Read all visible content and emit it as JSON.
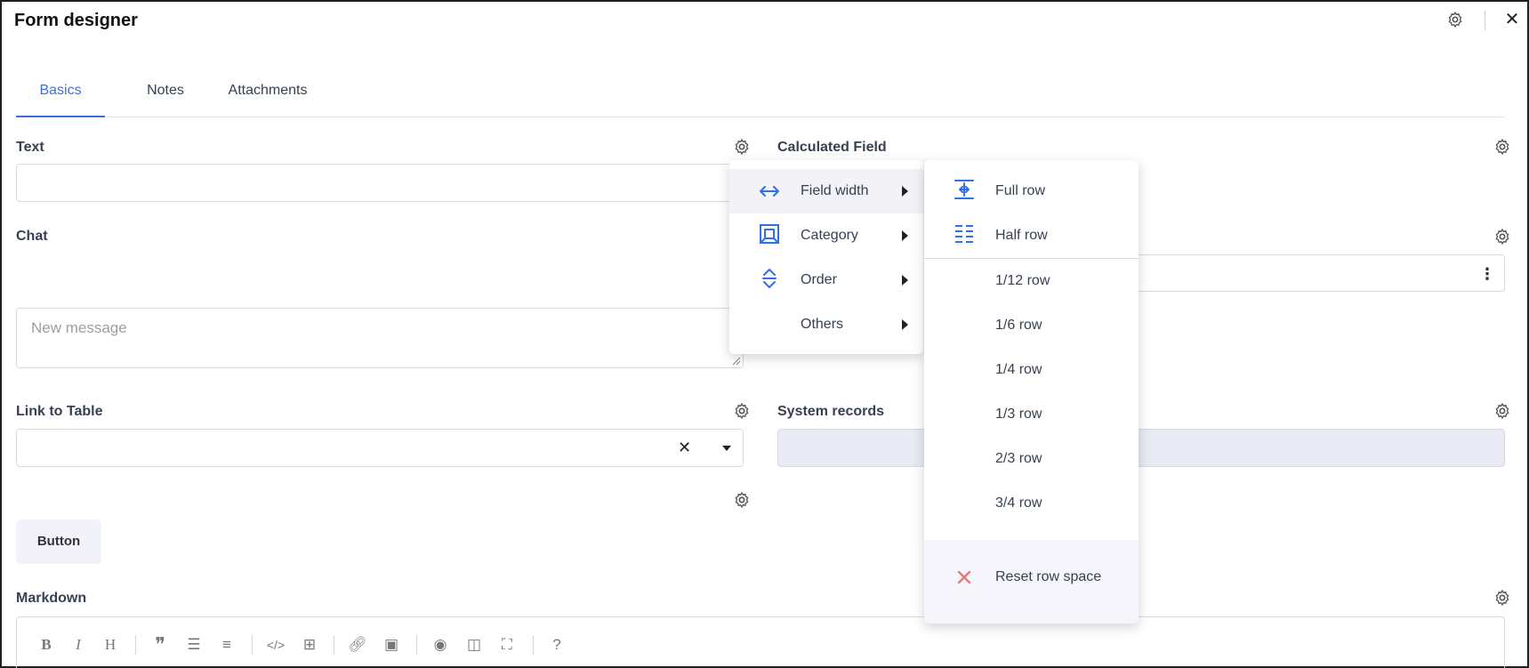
{
  "window": {
    "title": "Form designer"
  },
  "tabs": [
    {
      "label": "Basics",
      "active": true
    },
    {
      "label": "Notes",
      "active": false
    },
    {
      "label": "Attachments",
      "active": false
    }
  ],
  "fields": {
    "text": {
      "label": "Text"
    },
    "calculated": {
      "label": "Calculated Field"
    },
    "chat": {
      "label": "Chat",
      "placeholder": "New message"
    },
    "link_to_table": {
      "label": "Link to Table"
    },
    "system_records": {
      "label": "System records"
    },
    "button": {
      "label": "Button"
    },
    "markdown": {
      "label": "Markdown"
    }
  },
  "markdown_toolbar": [
    "bold-icon",
    "italic-icon",
    "heading-icon",
    "quote-icon",
    "bullet-list-icon",
    "numbered-list-icon",
    "code-icon",
    "table-icon",
    "link-icon",
    "image-icon",
    "preview-icon",
    "side-by-side-icon",
    "fullscreen-icon",
    "help-icon"
  ],
  "context_menu": {
    "items": [
      {
        "label": "Field width",
        "icon": "field-width-icon",
        "hover": true
      },
      {
        "label": "Category",
        "icon": "category-icon"
      },
      {
        "label": "Order",
        "icon": "order-icon"
      },
      {
        "label": "Others",
        "icon": ""
      }
    ]
  },
  "width_submenu": {
    "items_top": [
      {
        "label": "Full row",
        "icon": "full-row-icon"
      },
      {
        "label": "Half row",
        "icon": "half-row-icon"
      }
    ],
    "items": [
      "1/12 row",
      "1/6 row",
      "1/4 row",
      "1/3 row",
      "2/3 row",
      "3/4 row"
    ],
    "reset": {
      "label": "Reset row space",
      "icon": "reset-x-icon"
    }
  },
  "colors": {
    "accent": "#3b6fe0",
    "reset_x": "#e07a7a",
    "menu_icon": "#2f6fe8"
  }
}
